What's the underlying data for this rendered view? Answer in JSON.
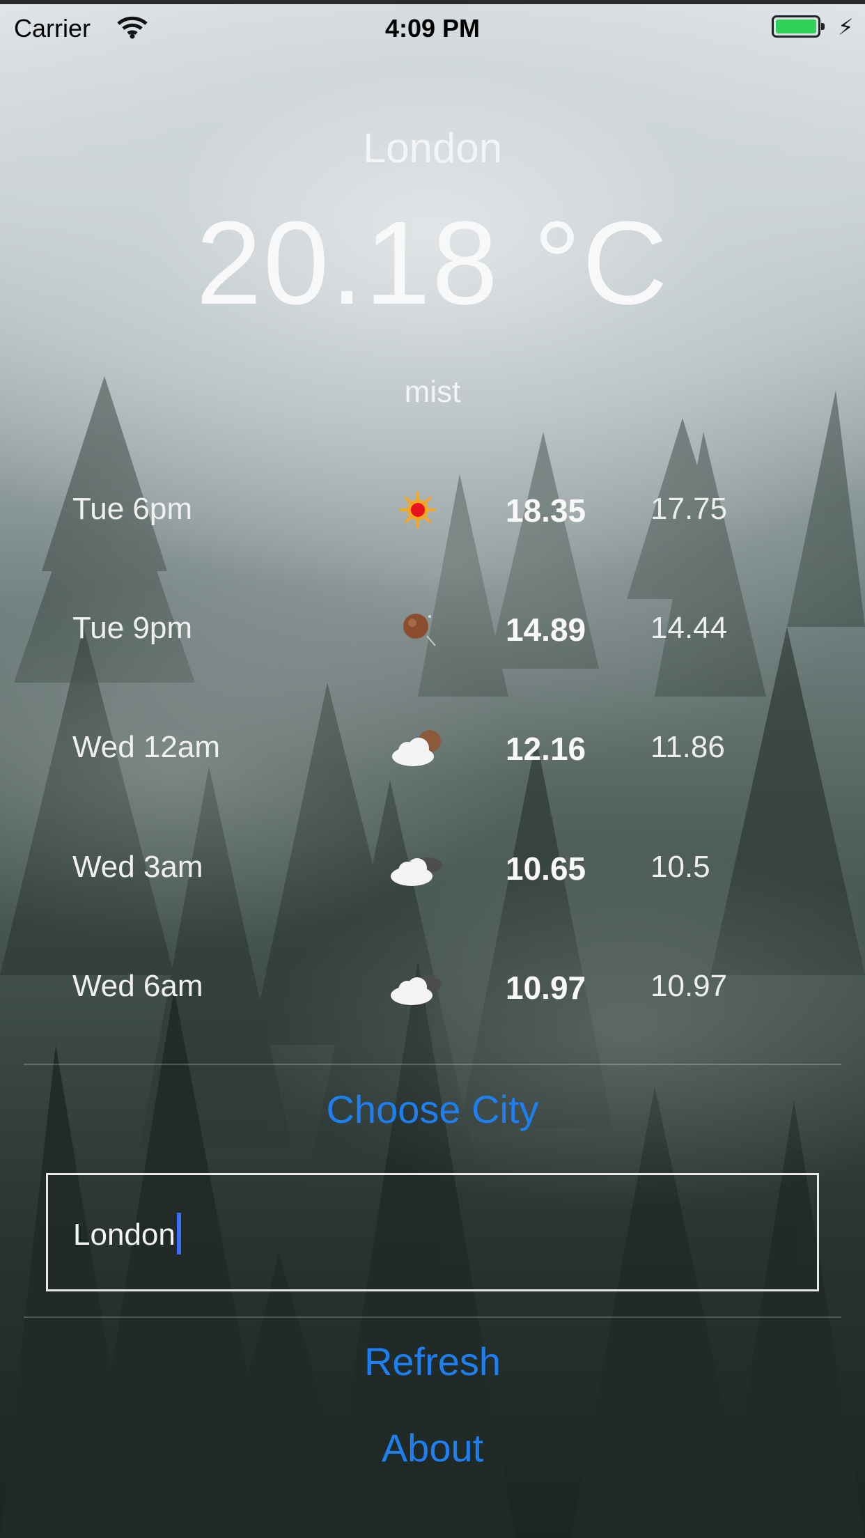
{
  "status_bar": {
    "carrier": "Carrier",
    "time": "4:09 PM",
    "battery_color": "#2fd158"
  },
  "weather": {
    "city": "London",
    "temperature": "20.18 °C",
    "description": "mist"
  },
  "forecast": [
    {
      "time": "Tue 6pm",
      "icon": "sun-icon",
      "high": "18.35",
      "low": "17.75"
    },
    {
      "time": "Tue 9pm",
      "icon": "moon-icon",
      "high": "14.89",
      "low": "14.44"
    },
    {
      "time": "Wed 12am",
      "icon": "cloud-moon-icon",
      "high": "12.16",
      "low": "11.86"
    },
    {
      "time": "Wed 3am",
      "icon": "cloudy-icon",
      "high": "10.65",
      "low": "10.5"
    },
    {
      "time": "Wed 6am",
      "icon": "cloudy-icon",
      "high": "10.97",
      "low": "10.97"
    }
  ],
  "controls": {
    "choose_city_label": "Choose City",
    "city_input_value": "London",
    "refresh_label": "Refresh",
    "about_label": "About",
    "accent_color": "#1d7ff0"
  }
}
